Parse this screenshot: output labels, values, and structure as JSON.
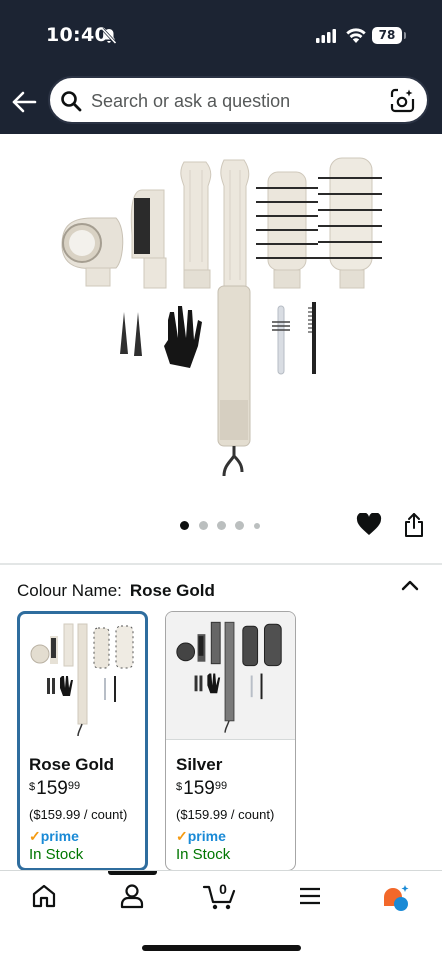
{
  "status": {
    "time": "10:40",
    "battery": "78"
  },
  "search": {
    "placeholder": "Search or ask a question"
  },
  "product": {
    "image_count": 5,
    "selected_image": 1
  },
  "variant": {
    "label": "Colour Name:",
    "selected": "Rose Gold",
    "options": [
      {
        "name": "Rose Gold",
        "currency": "$",
        "price_whole": "159",
        "price_fraction": "99",
        "unit_price": "($159.99 / count)",
        "prime": "prime",
        "stock": "In Stock"
      },
      {
        "name": "Silver",
        "currency": "$",
        "price_whole": "159",
        "price_fraction": "99",
        "unit_price": "($159.99 / count)",
        "prime": "prime",
        "stock": "In Stock"
      }
    ]
  },
  "nav": {
    "cart_count": "0",
    "active": "account"
  },
  "colors": {
    "header": "#1c2433",
    "selected_border": "#2f6d9e",
    "stock_green": "#007600",
    "prime_blue": "#1a8ad6",
    "rufus_orange": "#f2682a",
    "rufus_blue": "#1a8ad6"
  }
}
